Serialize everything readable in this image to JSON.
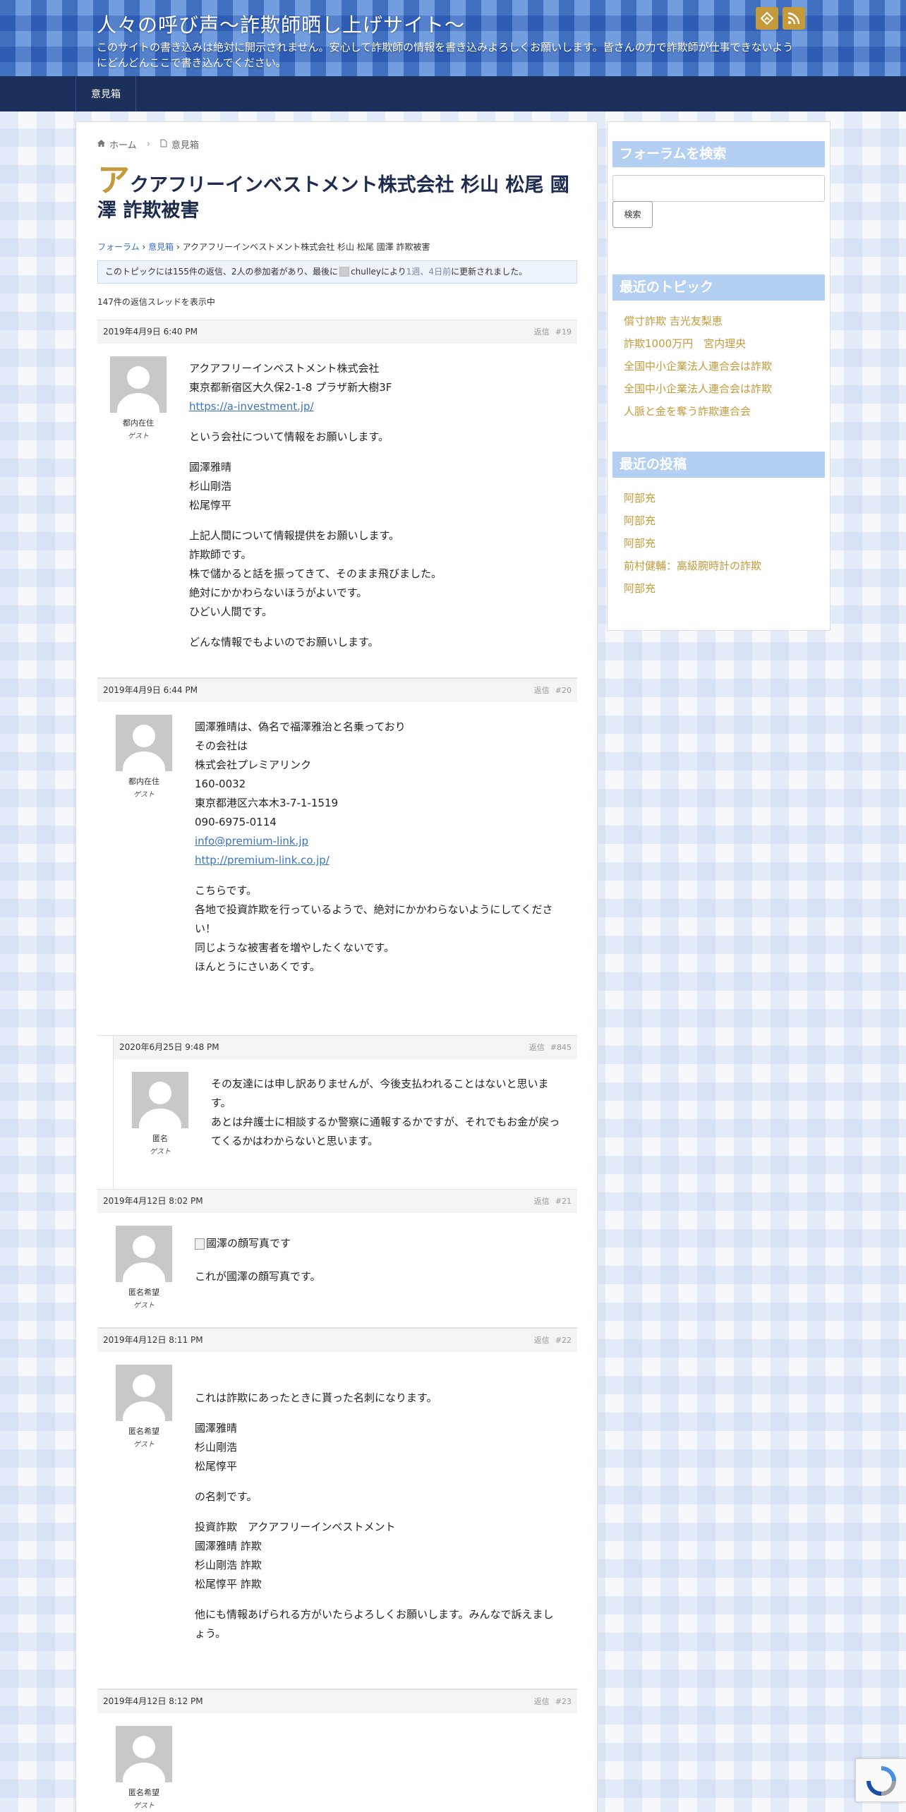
{
  "header": {
    "site_title": "人々の呼び声～詐欺師晒し上げサイト～",
    "site_description": "このサイトの書き込みは絶対に開示されません。安心して詐欺師の情報を書き込みよろしくお願いします。皆さんの力で詐欺師が仕事できないようにどんどんここで書き込んでください。",
    "icons": [
      "feedly-icon",
      "rss-icon"
    ],
    "accent_color": "#c49a3a"
  },
  "nav": {
    "items": [
      "意見箱"
    ]
  },
  "breadcrumb": {
    "home": "ホーム",
    "current": "意見箱"
  },
  "post": {
    "title_first": "ア",
    "title_rest": "クアフリーインベストメント株式会社 杉山 松尾 國澤 詐欺被害"
  },
  "forum_breadcrumb": {
    "forum": "フォーラム",
    "sep": "›",
    "box": "意見箱",
    "topic": "アクアフリーインベストメント株式会社 杉山 松尾 國澤 詐欺被害"
  },
  "notice": {
    "before": "このトピックには155件の返信、2人の参加者があり、最後に",
    "user": "chulley",
    "by": "により",
    "time1": "1週、4日前",
    "after": "に更新されました。"
  },
  "reply_count": "147件の返信スレッドを表示中",
  "reply_label": "返信",
  "replies": [
    {
      "date": "2019年4月9日 6:40 PM",
      "num": "#19",
      "author": "都内在住",
      "role": "ゲスト",
      "paragraphs": [
        [
          "アクアフリーインベストメント株式会社",
          "東京都新宿区大久保2-1-8 プラザ新大樹3F"
        ],
        [
          "という会社について情報をお願いします。"
        ],
        [
          "國澤雅晴",
          "杉山剛浩",
          "松尾惇平"
        ],
        [
          "上記人間について情報提供をお願いします。",
          "詐欺師です。",
          "株で儲かると話を振ってきて、そのまま飛びました。",
          "絶対にかかわらないほうがよいです。",
          "ひどい人間です。"
        ],
        [
          "どんな情報でもよいのでお願いします。"
        ]
      ],
      "link": "https://a-investment.jp/"
    },
    {
      "date": "2019年4月9日 6:44 PM",
      "num": "#20",
      "author": "都内在住",
      "role": "ゲスト",
      "lines": [
        "國澤雅晴は、偽名で福澤雅治と名乗っており",
        "その会社は",
        "株式会社プレミアリンク",
        "160-0032",
        "東京都港区六本木3-7-1-1519",
        "090-6975-0114"
      ],
      "links": [
        "info@premium-link.jp",
        "http://premium-link.co.jp/"
      ],
      "lines2": [
        "こちらです。",
        "各地で投資詐欺を行っているようで、絶対にかかわらないようにしてください！",
        "同じような被害者を増やしたくないです。",
        "ほんとうにさいあくです。"
      ]
    },
    {
      "date": "2020年6月25日 9:48 PM",
      "num": "#845",
      "author": "匿名",
      "role": "ゲスト",
      "lines": [
        "その友達には申し訳ありませんが、今後支払われることはないと思います。",
        "あとは弁護士に相談するか警察に通報するかですが、それでもお金が戻ってくるかはわからないと思います。"
      ]
    },
    {
      "date": "2019年4月12日 8:02 PM",
      "num": "#21",
      "author": "匿名希望",
      "role": "ゲスト",
      "img_alt": "國澤の顔写真です",
      "text": "これが國澤の顔写真です。"
    },
    {
      "date": "2019年4月12日 8:11 PM",
      "num": "#22",
      "author": "匿名希望",
      "role": "ゲスト",
      "paragraphs": [
        [
          "これは詐欺にあったときに貰った名刺になります。"
        ],
        [
          "國澤雅晴",
          "杉山剛浩",
          "松尾惇平"
        ],
        [
          "の名刺です。"
        ],
        [
          "投資詐欺　アクアフリーインベストメント",
          "國澤雅晴 詐欺",
          "杉山剛浩 詐欺",
          "松尾惇平 詐欺"
        ],
        [
          "他にも情報あげられる方がいたらよろしくお願いします。みんなで訴えましょう。"
        ]
      ]
    },
    {
      "date": "2019年4月12日 8:12 PM",
      "num": "#23",
      "author": "匿名希望",
      "role": "ゲスト"
    }
  ],
  "sidebar": {
    "search_title": "フォーラムを検索",
    "search_button": "検索",
    "topics_title": "最近のトピック",
    "topics": [
      "償寸詐欺 吉光友梨恵",
      "詐欺1000万円　宮内理央",
      "全国中小企業法人連合会は詐欺",
      "全国中小企業法人連合会は詐欺",
      "人脈と金を奪う詐欺連合会"
    ],
    "posts_title": "最近の投稿",
    "posts": [
      "阿部充",
      "阿部充",
      "阿部充",
      "前村健輔：高級腕時計の詐欺",
      "阿部充"
    ]
  }
}
